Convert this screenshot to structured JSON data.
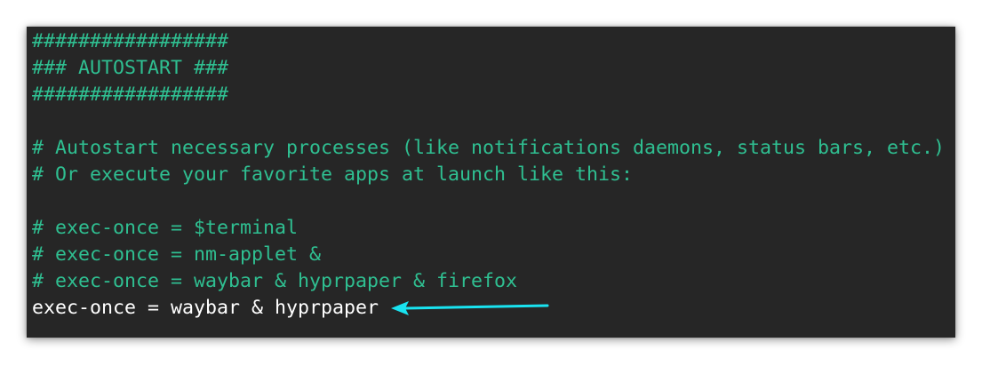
{
  "config": {
    "lines": [
      {
        "text": "#################",
        "kind": "comment"
      },
      {
        "text": "### AUTOSTART ###",
        "kind": "comment"
      },
      {
        "text": "#################",
        "kind": "comment"
      },
      {
        "text": "",
        "kind": "blank"
      },
      {
        "text": "# Autostart necessary processes (like notifications daemons, status bars, etc.)",
        "kind": "comment"
      },
      {
        "text": "# Or execute your favorite apps at launch like this:",
        "kind": "comment"
      },
      {
        "text": "",
        "kind": "blank"
      },
      {
        "text": "# exec-once = $terminal",
        "kind": "comment"
      },
      {
        "text": "# exec-once = nm-applet &",
        "kind": "comment"
      },
      {
        "text": "# exec-once = waybar & hyprpaper & firefox",
        "kind": "comment"
      },
      {
        "text": "exec-once = waybar & hyprpaper",
        "kind": "code"
      }
    ]
  },
  "colors": {
    "background": "#262626",
    "comment": "#2fbf91",
    "code": "#ffffff",
    "arrow": "#19e3f0"
  },
  "annotation": {
    "icon": "left-arrow-icon"
  }
}
